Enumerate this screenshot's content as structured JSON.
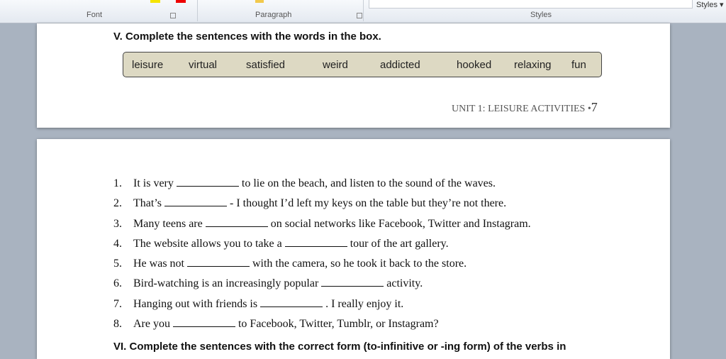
{
  "ribbon": {
    "groups": [
      "Font",
      "Paragraph",
      "Styles"
    ],
    "styles_button": "Styles ▾"
  },
  "page1": {
    "heading": "V.  Complete the sentences with the words in the box.",
    "words": [
      "leisure",
      "virtual",
      "satisfied",
      "weird",
      "addicted",
      "hooked",
      "relaxing",
      "fun"
    ],
    "footer": "UNIT 1: LEISURE ACTIVITIES •",
    "page_number": "7"
  },
  "page2": {
    "items": [
      {
        "n": "1.",
        "pre": "It is very",
        "post": "to lie on the beach, and listen to the sound of the waves."
      },
      {
        "n": "2.",
        "pre": "That’s",
        "post": "- I thought I’d left my keys on the table but they’re not there."
      },
      {
        "n": "3.",
        "pre": "Many teens are",
        "post": "on social networks like Facebook, Twitter and Instagram."
      },
      {
        "n": "4.",
        "pre": "The website allows you to take a",
        "post": "tour of the art gallery."
      },
      {
        "n": "5.",
        "pre": "He was not",
        "post": "with the camera, so he took it back to the store."
      },
      {
        "n": "6.",
        "pre": "Bird-watching is an increasingly popular",
        "post": "activity."
      },
      {
        "n": "7.",
        "pre": "Hanging out with friends is",
        "post": ". I really enjoy it."
      },
      {
        "n": "8.",
        "pre": "Are you",
        "post": "to Facebook, Twitter, Tumblr, or Instagram?"
      }
    ],
    "heading": "VI. Complete the sentences with the correct form (to-infinitive or -ing form) of the verbs in"
  }
}
